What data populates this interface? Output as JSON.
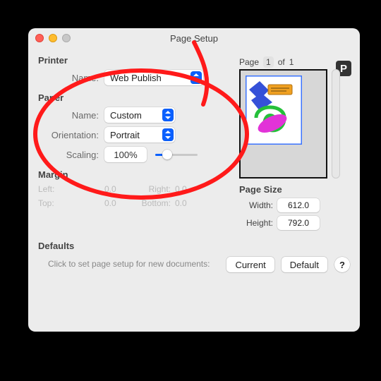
{
  "window": {
    "title": "Page Setup"
  },
  "printer": {
    "section_label": "Printer",
    "name_label": "Name:",
    "name_value": "Web Publish"
  },
  "paper": {
    "section_label": "Paper",
    "name_label": "Name:",
    "name_value": "Custom",
    "orientation_label": "Orientation:",
    "orientation_value": "Portrait",
    "scaling_label": "Scaling:",
    "scaling_value": "100%"
  },
  "margin": {
    "section_label": "Margin",
    "left_label": "Left:",
    "left_value": "0.0",
    "right_label": "Right:",
    "right_value": "0.0",
    "top_label": "Top:",
    "top_value": "0.0",
    "bottom_label": "Bottom:",
    "bottom_value": "0.0"
  },
  "page_nav": {
    "page_label": "Page",
    "page_current": "1",
    "of_label": "of",
    "page_total": "1"
  },
  "page_size": {
    "section_label": "Page Size",
    "width_label": "Width:",
    "width_value": "612.0",
    "height_label": "Height:",
    "height_value": "792.0"
  },
  "defaults": {
    "section_label": "Defaults",
    "hint": "Click to set page setup for new documents:",
    "current_button": "Current",
    "default_button": "Default",
    "help_button": "?"
  },
  "icons": {
    "parking": "P"
  },
  "annotation": {
    "stroke": "#ff1a1a",
    "stroke_width": 6
  }
}
